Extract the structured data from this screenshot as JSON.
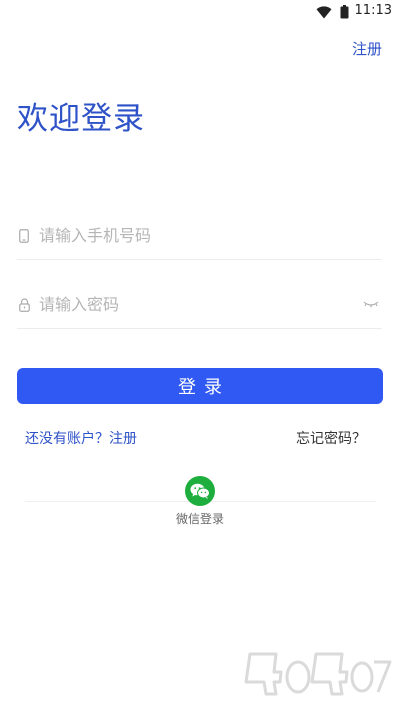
{
  "status_bar": {
    "time": "11:13",
    "icons": [
      "wifi-icon",
      "battery-icon"
    ]
  },
  "header": {
    "register_label": "注册",
    "title": "欢迎登录"
  },
  "form": {
    "phone_placeholder": "请输入手机号码",
    "phone_icon": "phone-icon",
    "password_placeholder": "请输入密码",
    "password_icon": "lock-icon",
    "password_toggle_icon": "eye-closed-icon",
    "login_label": "登录"
  },
  "links": {
    "no_account": "还没有账户？注册",
    "forgot": "忘记密码？"
  },
  "social": {
    "wechat_label": "微信登录",
    "wechat_icon": "wechat-icon",
    "wechat_color": "#1DAE3D"
  },
  "colors": {
    "accent": "#2E52C7",
    "button": "#2F59F2"
  }
}
